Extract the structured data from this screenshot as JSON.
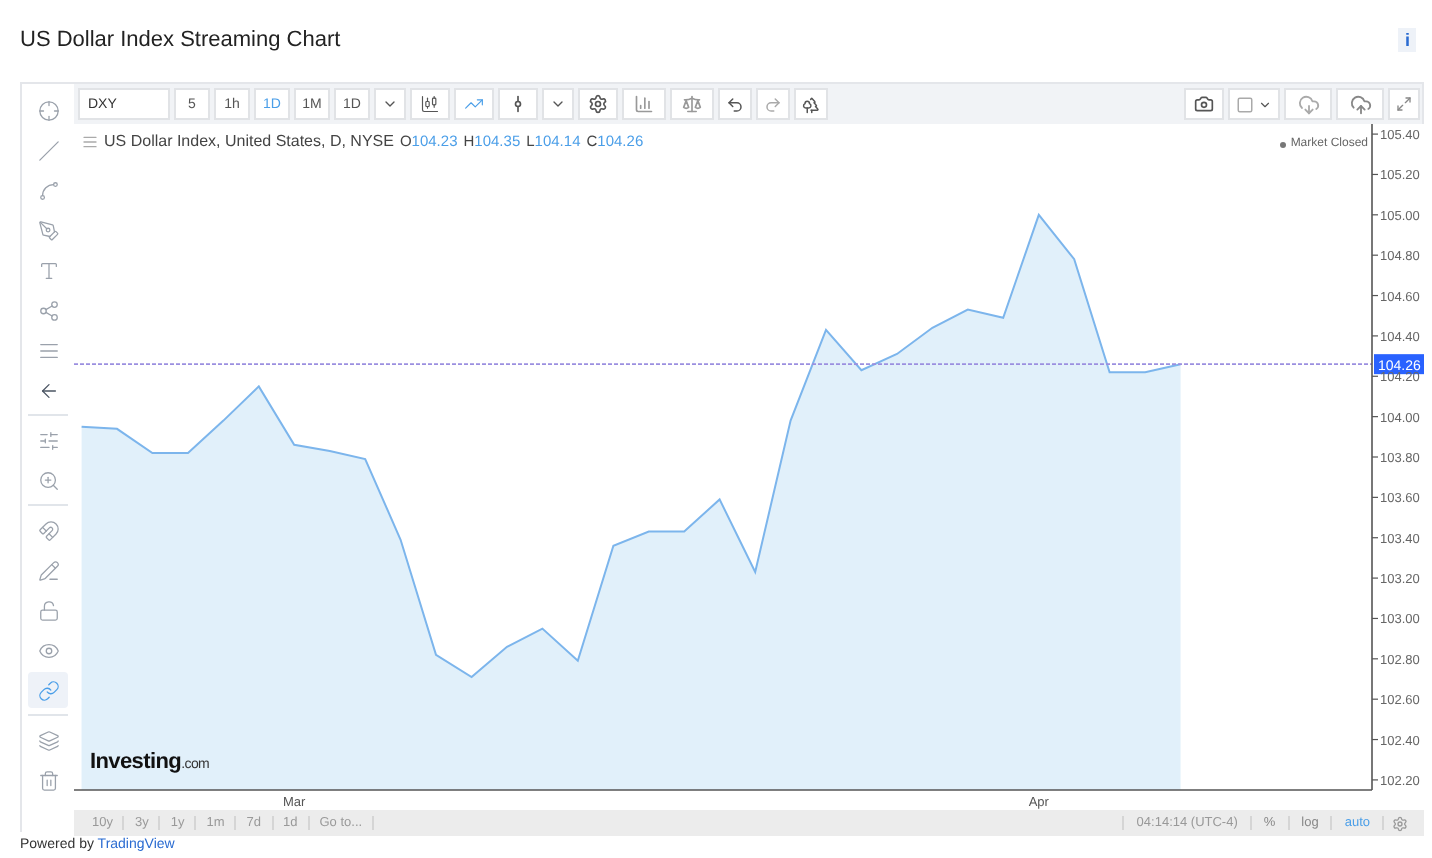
{
  "page": {
    "title": "US Dollar Index Streaming Chart",
    "info": "i"
  },
  "left_toolbar": [
    {
      "selected": false
    },
    {
      "selected": false
    },
    {
      "selected": false
    },
    {
      "selected": false
    },
    {
      "selected": false
    },
    {
      "selected": false
    },
    {
      "selected": false
    },
    {
      "selected": false
    },
    {
      "selected": false
    },
    {
      "selected": false
    },
    {
      "selected": false
    },
    {
      "selected": false
    },
    {
      "selected": false
    },
    {
      "selected": false
    },
    {
      "selected": true
    },
    {
      "selected": false
    },
    {
      "selected": false
    }
  ],
  "top_toolbar": {
    "symbol": "DXY",
    "intervals": [
      {
        "label": "5",
        "selected": false
      },
      {
        "label": "1h",
        "selected": false
      },
      {
        "label": "1D",
        "selected": true
      },
      {
        "label": "1M",
        "selected": false
      }
    ],
    "interval_dropdown": "1D",
    "chart_types": [
      {
        "selected": false
      },
      {
        "selected": true
      }
    ]
  },
  "legend": {
    "title": "US Dollar Index, United States, D, NYSE",
    "ohlc": [
      {
        "key": "O",
        "value": "104.23"
      },
      {
        "key": "H",
        "value": "104.35"
      },
      {
        "key": "L",
        "value": "104.14"
      },
      {
        "key": "C",
        "value": "104.26"
      }
    ],
    "status": "Market Closed"
  },
  "logo": {
    "name": "Investing",
    "suffix": ".com"
  },
  "chart": {
    "chart_data": {
      "type": "area",
      "categories": [
        null,
        null,
        null,
        null,
        null,
        null,
        "Mar",
        null,
        null,
        null,
        null,
        null,
        null,
        null,
        null,
        null,
        null,
        null,
        null,
        null,
        null,
        null,
        null,
        null,
        null,
        null,
        null,
        "Apr",
        null,
        null,
        null,
        null
      ],
      "series": [
        {
          "color": "#7cb5ec",
          "values": [
            103.95,
            103.94,
            103.82,
            103.82,
            103.98,
            104.15,
            103.86,
            103.83,
            103.79,
            103.39,
            102.82,
            102.71,
            102.86,
            102.95,
            102.79,
            103.36,
            103.43,
            103.43,
            103.59,
            103.23,
            103.98,
            104.43,
            104.23,
            104.31,
            104.44,
            104.53,
            104.49,
            105.0,
            104.78,
            104.22,
            104.22,
            104.26
          ]
        }
      ],
      "ylim": [
        102.15,
        105.45
      ],
      "yticks": [
        {
          "value": 102.2,
          "label": "102.20"
        },
        {
          "value": 102.4,
          "label": "102.40"
        },
        {
          "value": 102.6,
          "label": "102.60"
        },
        {
          "value": 102.8,
          "label": "102.80"
        },
        {
          "value": 103.0,
          "label": "103.00"
        },
        {
          "value": 103.2,
          "label": "103.20"
        },
        {
          "value": 103.4,
          "label": "103.40"
        },
        {
          "value": 103.6,
          "label": "103.60"
        },
        {
          "value": 103.8,
          "label": "103.80"
        },
        {
          "value": 104.0,
          "label": "104.00"
        },
        {
          "value": 104.2,
          "label": "104.20"
        },
        {
          "value": 104.4,
          "label": "104.40"
        },
        {
          "value": 104.6,
          "label": "104.60"
        },
        {
          "value": 104.8,
          "label": "104.80"
        },
        {
          "value": 105.0,
          "label": "105.00"
        },
        {
          "value": 105.2,
          "label": "105.20"
        },
        {
          "value": 105.4,
          "label": "105.40"
        }
      ],
      "ref_lines": [
        {
          "value": 104.26,
          "axis": "y",
          "label": "104.26",
          "color": "#9b8fe0"
        }
      ]
    }
  },
  "bottom_bar": {
    "ranges": [
      "10y",
      "3y",
      "1y",
      "1m",
      "7d",
      "1d",
      "Go to..."
    ],
    "time": "04:14:14 (UTC-4)",
    "scales": [
      {
        "label": "%",
        "selected": false
      },
      {
        "label": "log",
        "selected": false
      },
      {
        "label": "auto",
        "selected": true
      }
    ]
  },
  "footer": {
    "text": "Powered by",
    "link": "TradingView"
  }
}
